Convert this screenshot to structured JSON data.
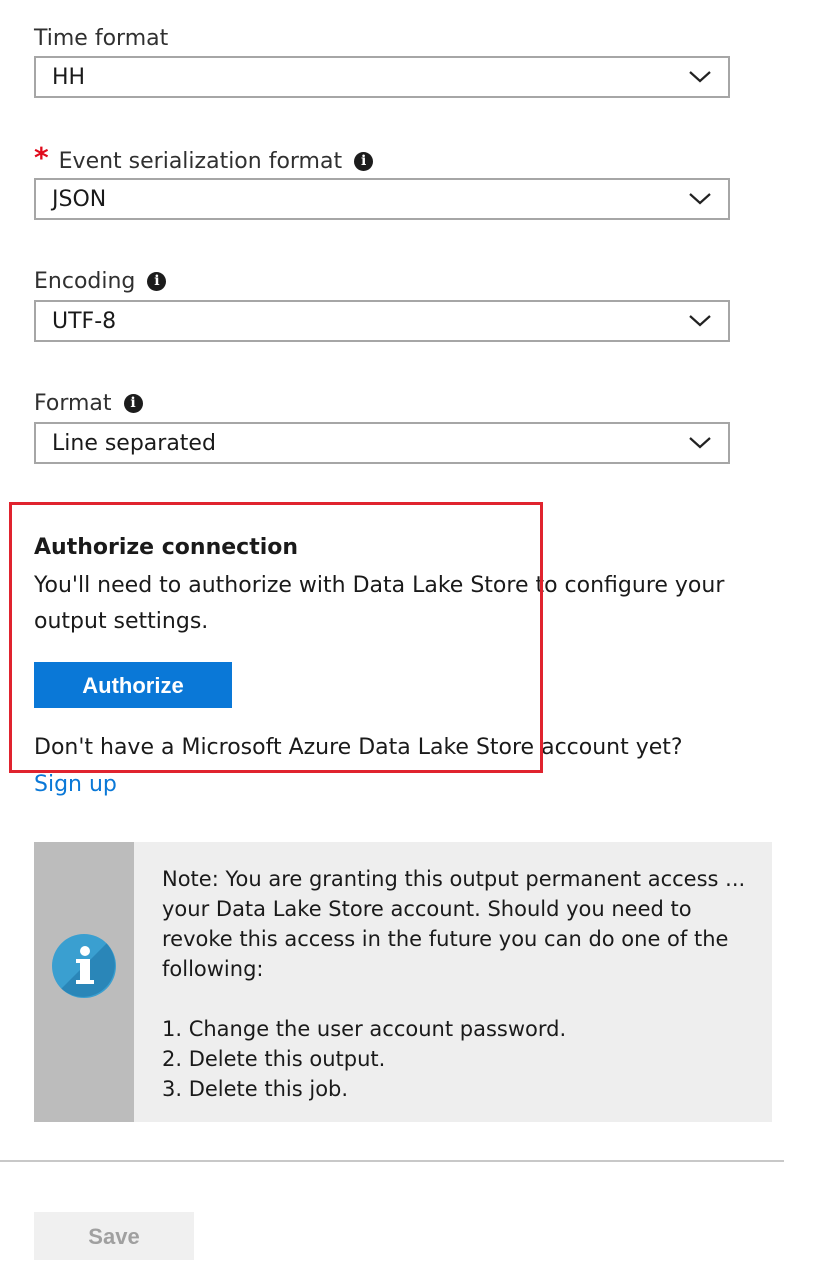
{
  "fields": {
    "time_format": {
      "label": "Time format",
      "value": "HH"
    },
    "serialization": {
      "required_mark": "*",
      "label": "Event serialization format",
      "value": "JSON"
    },
    "encoding": {
      "label": "Encoding",
      "value": "UTF-8"
    },
    "format": {
      "label": "Format",
      "value": "Line separated"
    },
    "info_glyph": "i"
  },
  "auth": {
    "title": "Authorize connection",
    "description": "You'll need to authorize with Data Lake Store to configure your output settings.",
    "button_label": "Authorize",
    "no_account_text": "Don't have a Microsoft Azure Data Lake Store account yet?",
    "signup_label": "Sign up"
  },
  "note": {
    "icon": "info-icon",
    "text": "Note: You are granting this output permanent access ... your Data Lake Store account. Should you need to revoke this access in the future you can do one of the following:",
    "steps": [
      "1. Change the user account password.",
      "2. Delete this output.",
      "3. Delete this job."
    ]
  },
  "footer": {
    "save_label": "Save"
  },
  "colors": {
    "accent": "#0a78d7",
    "required": "#e00b1c",
    "highlight": "#e0232e",
    "note_bg": "#eeeeee",
    "note_side": "#bcbcbc"
  }
}
